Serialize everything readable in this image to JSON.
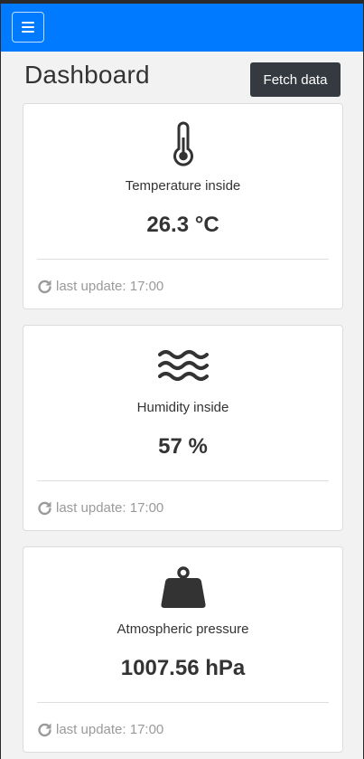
{
  "header": {
    "menu_icon": "hamburger-menu-icon",
    "title": "Dashboard",
    "fetch_label": "Fetch data"
  },
  "colors": {
    "topbar": "#007bff",
    "button_dark": "#343a40",
    "muted_text": "#9a9a9a"
  },
  "cards": [
    {
      "icon": "thermometer-icon",
      "label": "Temperature inside",
      "value": "26.3 °C",
      "update_icon": "refresh-icon",
      "update": "last update: 17:00"
    },
    {
      "icon": "waves-icon",
      "label": "Humidity inside",
      "value": "57 %",
      "update_icon": "refresh-icon",
      "update": "last update: 17:00"
    },
    {
      "icon": "weight-icon",
      "label": "Atmospheric pressure",
      "value": "1007.56 hPa",
      "update_icon": "refresh-icon",
      "update": "last update: 17:00"
    }
  ]
}
